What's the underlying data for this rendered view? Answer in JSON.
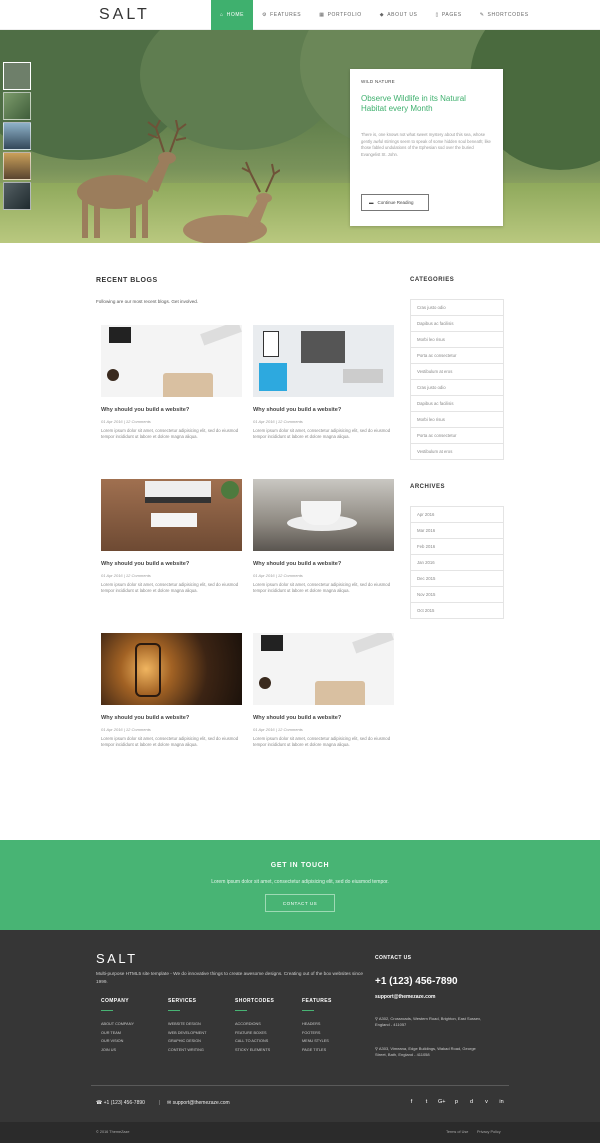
{
  "header": {
    "logo": "SALT",
    "nav": [
      {
        "label": "HOME",
        "icon": "home-icon"
      },
      {
        "label": "FEATURES",
        "icon": "gear-icon"
      },
      {
        "label": "PORTFOLIO",
        "icon": "grid-icon"
      },
      {
        "label": "ABOUT US",
        "icon": "diamond-icon"
      },
      {
        "label": "PAGES",
        "icon": "page-icon"
      },
      {
        "label": "SHORTCODES",
        "icon": "pencil-icon"
      }
    ]
  },
  "hero": {
    "kicker": "WILD NATURE",
    "title": "Observe Wildlife in its Natural Habitat every Month",
    "text": "There is, one knows not what sweet mystery about this sea, whose gently awful stirrings seem to speak of some hidden soul beneath; like those fabled undulations of the Ephesian sod over the buried Evangelist St. John.",
    "button": "Continue Reading"
  },
  "blog": {
    "title": "RECENT BLOGS",
    "intro": "Following are our most recent blogs. Get involved.",
    "posts": [
      {
        "title": "Why should you build a website?",
        "meta": "01 Apr 2016 | 12 Comments",
        "excerpt": "Lorem ipsum dolor sit amet, consectetur adipisicing elit, sed do eiusmod tempor incididunt ut labore et dolore magna aliqua."
      },
      {
        "title": "Why should you build a website?",
        "meta": "01 Apr 2016 | 12 Comments",
        "excerpt": "Lorem ipsum dolor sit amet, consectetur adipisicing elit, sed do eiusmod tempor incididunt ut labore et dolore magna aliqua."
      },
      {
        "title": "Why should you build a website?",
        "meta": "01 Apr 2016 | 12 Comments",
        "excerpt": "Lorem ipsum dolor sit amet, consectetur adipisicing elit, sed do eiusmod tempor incididunt ut labore et dolore magna aliqua."
      },
      {
        "title": "Why should you build a website?",
        "meta": "01 Apr 2016 | 12 Comments",
        "excerpt": "Lorem ipsum dolor sit amet, consectetur adipisicing elit, sed do eiusmod tempor incididunt ut labore et dolore magna aliqua."
      },
      {
        "title": "Why should you build a website?",
        "meta": "01 Apr 2016 | 12 Comments",
        "excerpt": "Lorem ipsum dolor sit amet, consectetur adipisicing elit, sed do eiusmod tempor incididunt ut labore et dolore magna aliqua."
      },
      {
        "title": "Why should you build a website?",
        "meta": "01 Apr 2016 | 12 Comments",
        "excerpt": "Lorem ipsum dolor sit amet, consectetur adipisicing elit, sed do eiusmod tempor incididunt ut labore et dolore magna aliqua."
      }
    ]
  },
  "sidebar": {
    "categories_title": "CATEGORIES",
    "categories": [
      "Cras justo odio",
      "Dapibus ac facilisis",
      "Morbi leo risus",
      "Porta ac consectetur",
      "Vestibulum at eros",
      "Cras justo odio",
      "Dapibus ac facilisis",
      "Morbi leo risus",
      "Porta ac consectetur",
      "Vestibulum at eros"
    ],
    "archives_title": "ARCHIVES",
    "archives": [
      "Apr 2016",
      "Mar 2016",
      "Feb 2016",
      "Jan 2016",
      "Dec 2015",
      "Nov 2015",
      "Oct 2015"
    ]
  },
  "cta": {
    "title": "GET IN TOUCH",
    "text": "Lorem ipsum dolor sit amet, consectetur adipisicing elit, sed do eiusmod tempor.",
    "button": "CONTACT US"
  },
  "footer": {
    "logo": "SALT",
    "about": "Multi-purpose HTML5 site template - We do innovative things to create awesome designs. Creating out of the box websites since 1999.",
    "columns": [
      {
        "title": "COMPANY",
        "links": [
          "ABOUT COMPANY",
          "OUR TEAM",
          "OUR VISION",
          "JOIN US"
        ]
      },
      {
        "title": "SERVICES",
        "links": [
          "WEBSITE DESIGN",
          "WEB DEVELOPMENT",
          "GRAPHIC DESIGN",
          "CONTENT WRITING"
        ]
      },
      {
        "title": "SHORTCODES",
        "links": [
          "ACCORDIONS",
          "FEATURE BOXES",
          "CALL TO ACTIONS",
          "STICKY ELEMENTS"
        ]
      },
      {
        "title": "FEATURES",
        "links": [
          "HEADERS",
          "FOOTERS",
          "MENU STYLES",
          "PAGE TITLES"
        ]
      }
    ],
    "contact_title": "CONTACT US",
    "phone": "+1 (123) 456-7890",
    "email": "support@themezaze.com",
    "addresses": [
      "A302, Crossroads, Western Road, Brighton, East Sussex, England - 411057",
      "A303, Vimeana, Edge Buildings, Wakad Road, George Street, Bath, England - 411058"
    ],
    "bottom_phone": "+1 (123) 456-7890",
    "bottom_sep": "|",
    "bottom_email": "support@themezaze.com",
    "socials": [
      "f",
      "t",
      "G+",
      "p",
      "d",
      "v",
      "in"
    ],
    "copyright": "© 2016 ThemeZaze",
    "terms": "Terms of Use",
    "privacy": "Privacy Policy"
  },
  "colors": {
    "accent": "#3fb06e",
    "footer_bg": "#363636"
  }
}
